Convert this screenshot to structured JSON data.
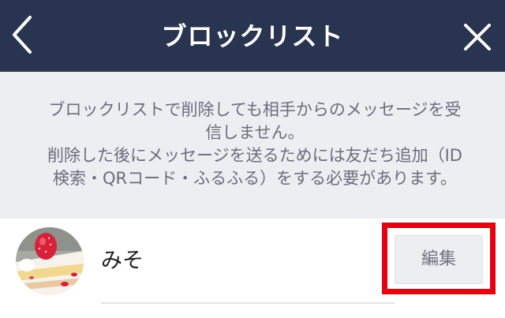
{
  "header": {
    "title": "ブロックリスト",
    "back_icon": "chevron-left-icon",
    "close_icon": "close-icon",
    "background_color": "#283450"
  },
  "notice": {
    "line1": "ブロックリストで削除しても相手からのメッセージを受",
    "line2": "信しません。",
    "line3": "削除した後にメッセージを送るためには友だち追加（ID",
    "line4": "検索・QRコード・ふるふる）をする必要があります。"
  },
  "blocked_list": [
    {
      "name": "みそ",
      "avatar_icon": "strawberry-cake-avatar",
      "edit_label": "編集"
    }
  ],
  "highlight_color": "#e60012"
}
